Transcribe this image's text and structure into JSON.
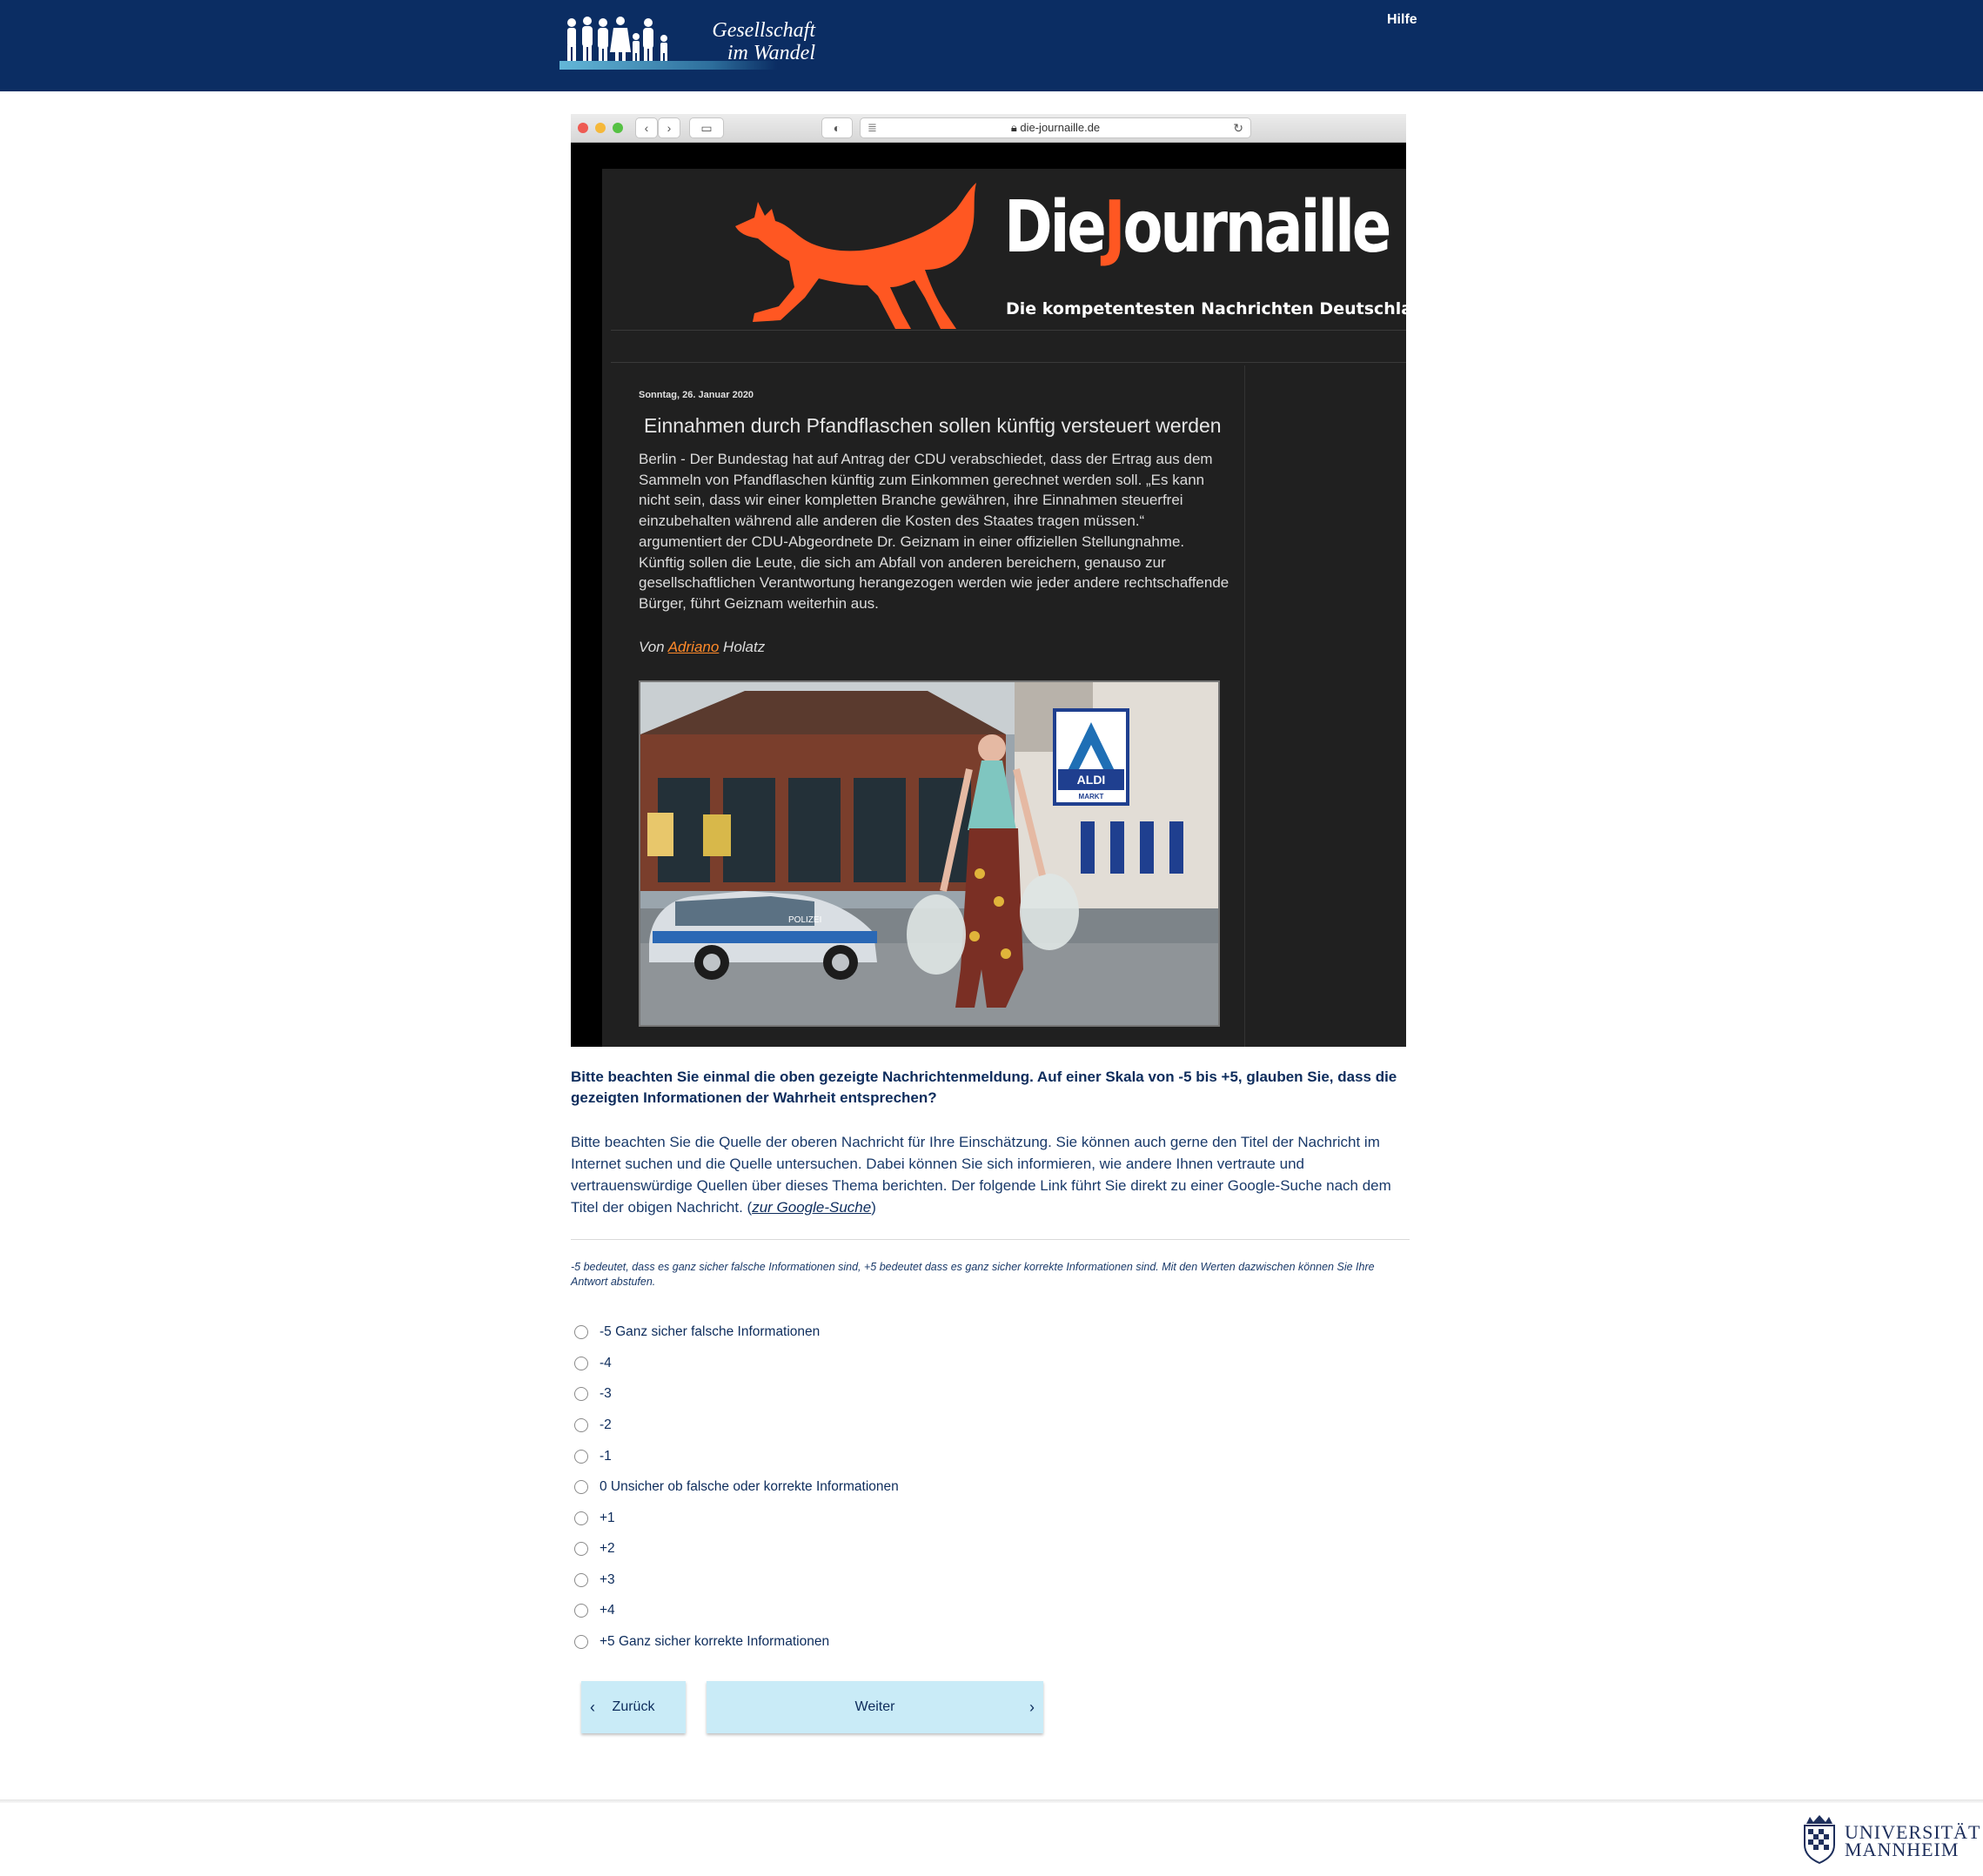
{
  "header": {
    "logo_text_line1": "Gesellschaft",
    "logo_text_line2": "im Wandel",
    "help_link": "Hilfe"
  },
  "browser": {
    "url": "die-journaille.de"
  },
  "site": {
    "brand_prefix": "Die",
    "brand_j": "J",
    "brand_rest": "ournaille",
    "tagline": "Die kompetentesten Nachrichten Deutschlands",
    "date": "Sonntag, 26. Januar 2020",
    "headline": "Einnahmen durch Pfandflaschen sollen künftig versteuert werden",
    "body": "Berlin - Der Bundestag hat auf Antrag der CDU verabschiedet, dass der Ertrag aus dem Sammeln von Pfandflaschen künftig zum Einkommen gerechnet werden soll. „Es kann nicht sein, dass wir einer kompletten Branche gewähren, ihre Einnahmen steuerfrei einzubehalten während alle anderen die Kosten des Staates tragen müssen.“ argumentiert der CDU-Abgeordnete Dr. Geiznam in einer offiziellen Stellungnahme. Künftig sollen die Leute, die sich am Abfall von anderen bereichern, genauso zur gesellschaftlichen Verantwortung herangezogen werden wie jeder andere rechtschaffende Bürger, führt Geiznam weiterhin aus.",
    "byline_prefix": "Von ",
    "byline_author_first": "Adriano",
    "byline_author_last": " Holatz",
    "photo_texts": {
      "store_sign": "ALDI",
      "store_sign_sub": "MARKT",
      "car_text": "POLIZEI"
    }
  },
  "question": {
    "prompt": "Bitte beachten Sie einmal die oben gezeigte Nachrichtenmeldung. Auf einer Skala von -5 bis +5, glauben Sie, dass die gezeigten Informationen der Wahrheit entsprechen?",
    "hint_text": "Bitte beachten Sie die Quelle der oberen Nachricht für Ihre Einschätzung. Sie können auch gerne den Titel der Nachricht im Internet suchen und die Quelle untersuchen. Dabei können Sie sich informieren, wie andere Ihnen vertraute und vertrauenswürdige Quellen über dieses Thema berichten. Der folgende Link führt Sie direkt zu einer Google-Suche nach dem Titel der obigen Nachricht. (",
    "hint_link": "zur Google-Suche",
    "hint_close": ")",
    "scale_note": "-5 bedeutet, dass es ganz sicher falsche Informationen sind, +5 bedeutet dass es ganz sicher korrekte Informationen sind. Mit den Werten dazwischen können Sie Ihre Antwort abstufen.",
    "options": [
      "-5 Ganz sicher falsche Informationen",
      "-4",
      "-3",
      "-2",
      "-1",
      "0 Unsicher ob falsche oder korrekte Informationen",
      "+1",
      "+2",
      "+3",
      "+4",
      "+5 Ganz sicher korrekte Informationen"
    ]
  },
  "nav": {
    "back_label": "Zurück",
    "next_label": "Weiter"
  },
  "footer": {
    "university_line1": "UNIVERSITÄT",
    "university_line2": "MANNHEIM"
  },
  "colors": {
    "header_bg": "#0b2d63",
    "text_navy": "#0d2c5c",
    "button_bg": "#c9ebf7",
    "brand_orange": "#ff5722"
  },
  "icons": [
    "family-silhouette-logo",
    "fox-logo",
    "chevron-left-icon",
    "chevron-right-icon",
    "reload-icon",
    "lock-icon",
    "university-seal-icon"
  ]
}
